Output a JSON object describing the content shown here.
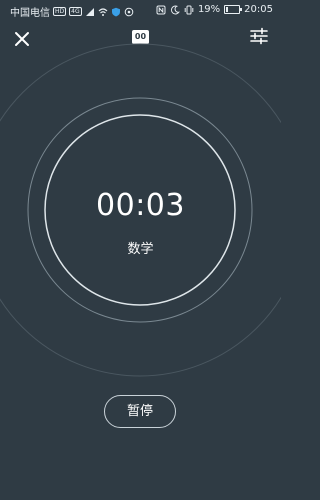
{
  "status_bar": {
    "carrier": "中国电信",
    "hd_badge": "HD",
    "signal_label": "4G",
    "battery_percent": "19%",
    "battery_level": 0.19,
    "time": "20:05"
  },
  "header": {
    "close_icon": "close-icon",
    "logo_text": "00",
    "settings_icon": "sliders-icon"
  },
  "timer": {
    "elapsed": "00:03",
    "subject": "数学"
  },
  "actions": {
    "pause_label": "暂停"
  },
  "colors": {
    "background": "#2f3b44",
    "ring_light": "#dfe6ea",
    "ring_mid": "#7a8891",
    "ring_dark": "#4a5760"
  }
}
